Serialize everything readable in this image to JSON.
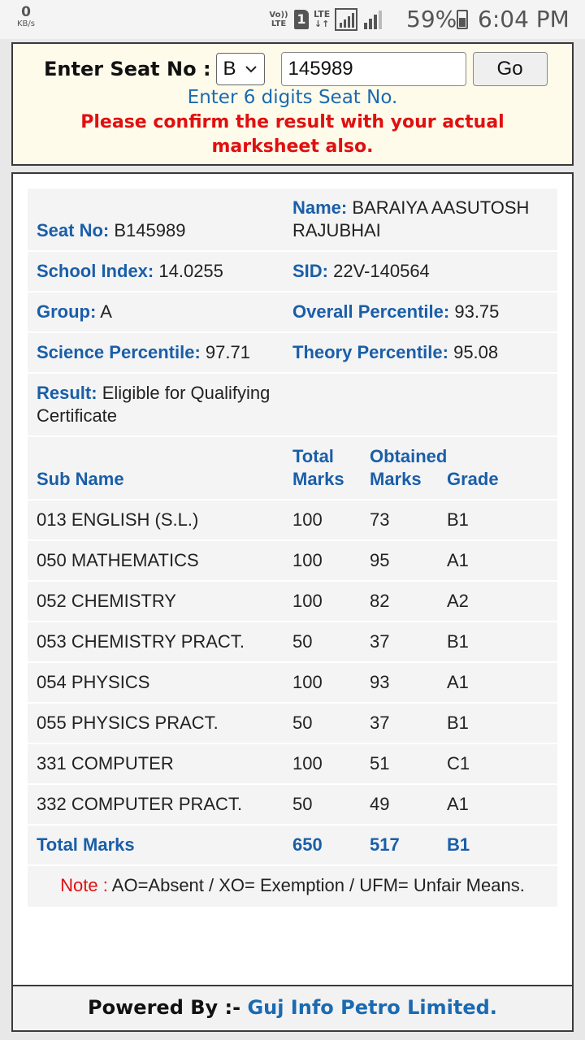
{
  "status_bar": {
    "data_speed": "0",
    "data_unit": "KB/s",
    "volte": "Vo)) LTE",
    "sim": "1",
    "network": "LTE",
    "battery": "59%",
    "time": "6:04 PM"
  },
  "form": {
    "label": "Enter Seat No :",
    "series_selected": "B",
    "seat_value": "145989",
    "go_label": "Go",
    "hint": "Enter 6 digits Seat No.",
    "warning": "Please confirm the result with your actual marksheet also."
  },
  "student": {
    "seat_label": "Seat No:",
    "seat_value": "B145989",
    "name_label": "Name:",
    "name_value": "BARAIYA AASUTOSH RAJUBHAI",
    "school_index_label": "School Index:",
    "school_index_value": "14.0255",
    "sid_label": "SID:",
    "sid_value": "22V-140564",
    "group_label": "Group:",
    "group_value": "A",
    "overall_label": "Overall Percentile:",
    "overall_value": "93.75",
    "science_label": "Science Percentile:",
    "science_value": "97.71",
    "theory_label": "Theory Percentile:",
    "theory_value": "95.08",
    "result_label": "Result:",
    "result_value": "Eligible for Qualifying Certificate"
  },
  "marks_table": {
    "headers": {
      "sub_name": "Sub Name",
      "total_marks": "Total Marks",
      "obtained_marks": "Obtained Marks",
      "grade": "Grade"
    },
    "rows": [
      {
        "sub": "013 ENGLISH (S.L.)",
        "total": "100",
        "obtained": "73",
        "grade": "B1"
      },
      {
        "sub": "050 MATHEMATICS",
        "total": "100",
        "obtained": "95",
        "grade": "A1"
      },
      {
        "sub": "052 CHEMISTRY",
        "total": "100",
        "obtained": "82",
        "grade": "A2"
      },
      {
        "sub": "053 CHEMISTRY PRACT.",
        "total": "50",
        "obtained": "37",
        "grade": "B1"
      },
      {
        "sub": "054 PHYSICS",
        "total": "100",
        "obtained": "93",
        "grade": "A1"
      },
      {
        "sub": "055 PHYSICS PRACT.",
        "total": "50",
        "obtained": "37",
        "grade": "B1"
      },
      {
        "sub": "331 COMPUTER",
        "total": "100",
        "obtained": "51",
        "grade": "C1"
      },
      {
        "sub": "332 COMPUTER PRACT.",
        "total": "50",
        "obtained": "49",
        "grade": "A1"
      }
    ],
    "total_row": {
      "label": "Total Marks",
      "total": "650",
      "obtained": "517",
      "grade": "B1"
    }
  },
  "note": {
    "label": "Note :",
    "text": "AO=Absent / XO= Exemption / UFM= Unfair Means."
  },
  "footer": {
    "label": "Powered By :-",
    "company": "Guj Info Petro Limited."
  },
  "colors": {
    "label_blue": "#1a5ea8",
    "warning_red": "#e01010",
    "header_bg": "#fffbea"
  }
}
